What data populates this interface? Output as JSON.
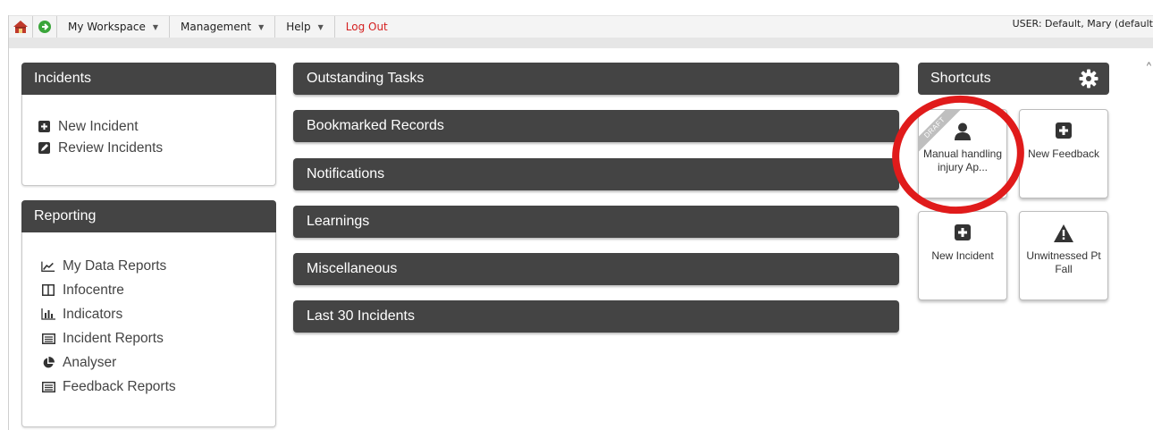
{
  "topbar": {
    "menu": [
      "My Workspace",
      "Management",
      "Help"
    ],
    "logout": "Log Out",
    "user": "USER: Default, Mary (default"
  },
  "incidents": {
    "title": "Incidents",
    "links": [
      "New Incident",
      "Review Incidents"
    ]
  },
  "reporting": {
    "title": "Reporting",
    "links": [
      "My Data Reports",
      "Infocentre",
      "Indicators",
      "Incident Reports",
      "Analyser",
      "Feedback Reports"
    ]
  },
  "sections": [
    "Outstanding Tasks",
    "Bookmarked Records",
    "Notifications",
    "Learnings",
    "Miscellaneous",
    "Last 30 Incidents"
  ],
  "shortcuts": {
    "title": "Shortcuts",
    "tiles": [
      {
        "label": "Manual handling injury Ap...",
        "ribbon": "DRAFT",
        "icon": "user-icon"
      },
      {
        "label": "New Feedback",
        "icon": "plus-square-icon"
      },
      {
        "label": "New Incident",
        "icon": "plus-square-icon"
      },
      {
        "label": "Unwitnessed Pt Fall",
        "icon": "warning-icon"
      }
    ]
  },
  "colors": {
    "header": "#444444",
    "logout": "#d42020",
    "annotation": "#e01b1b"
  }
}
